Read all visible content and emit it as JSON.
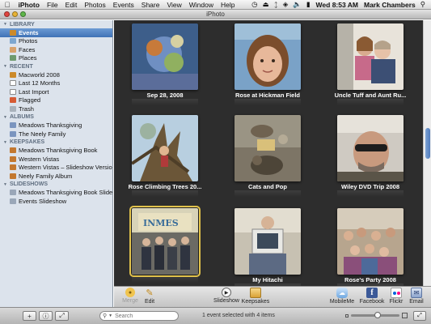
{
  "menubar": {
    "app": "iPhoto",
    "items": [
      "File",
      "Edit",
      "Photos",
      "Events",
      "Share",
      "View",
      "Window",
      "Help"
    ],
    "clock": "Wed 8:53 AM",
    "user": "Mark Chambers"
  },
  "window": {
    "title": "iPhoto"
  },
  "sidebar": {
    "sections": [
      {
        "title": "LIBRARY",
        "items": [
          {
            "label": "Events",
            "icon": "events-icon",
            "selected": true
          },
          {
            "label": "Photos",
            "icon": "photos-icon"
          },
          {
            "label": "Faces",
            "icon": "faces-icon"
          },
          {
            "label": "Places",
            "icon": "places-icon"
          }
        ]
      },
      {
        "title": "RECENT",
        "items": [
          {
            "label": "Macworld 2008",
            "icon": "event-icon"
          },
          {
            "label": "Last 12 Months",
            "icon": "calendar-icon"
          },
          {
            "label": "Last Import",
            "icon": "import-icon"
          },
          {
            "label": "Flagged",
            "icon": "flag-icon"
          },
          {
            "label": "Trash",
            "icon": "trash-icon"
          }
        ]
      },
      {
        "title": "ALBUMS",
        "items": [
          {
            "label": "Meadows Thanksgiving",
            "icon": "album-icon"
          },
          {
            "label": "The Neely Family",
            "icon": "album-icon"
          }
        ]
      },
      {
        "title": "KEEPSAKES",
        "items": [
          {
            "label": "Meadows Thanksgiving Book",
            "icon": "book-icon"
          },
          {
            "label": "Western Vistas",
            "icon": "book-icon"
          },
          {
            "label": "Western Vistas – Slideshow Version",
            "icon": "book-icon"
          },
          {
            "label": "Neely Family Album",
            "icon": "book-icon"
          }
        ]
      },
      {
        "title": "SLIDESHOWS",
        "items": [
          {
            "label": "Meadows Thanksgiving Book Slideshow",
            "icon": "slideshow-icon"
          },
          {
            "label": "Events Slideshow",
            "icon": "slideshow-icon"
          }
        ]
      }
    ]
  },
  "events": [
    {
      "caption": "Sep 28, 2008"
    },
    {
      "caption": "Rose at Hickman Field"
    },
    {
      "caption": "Uncle Tuff and Aunt Ru..."
    },
    {
      "caption": "Rose Climbing Trees 20..."
    },
    {
      "caption": "Cats and Pop"
    },
    {
      "caption": "Wiley DVD Trip 2008"
    },
    {
      "caption": "",
      "selected": true
    },
    {
      "caption": "My Hitachi"
    },
    {
      "caption": "Rose's Party 2008"
    }
  ],
  "toolbar": {
    "merge": "Merge",
    "edit": "Edit",
    "slideshow": "Slideshow",
    "keepsakes": "Keepsakes",
    "mobileme": "MobileMe",
    "facebook": "Facebook",
    "flickr": "Flickr",
    "email": "Email"
  },
  "statusbar": {
    "search_placeholder": "Search",
    "status": "1 event selected with 4 items",
    "zoom_level": 0.55
  }
}
